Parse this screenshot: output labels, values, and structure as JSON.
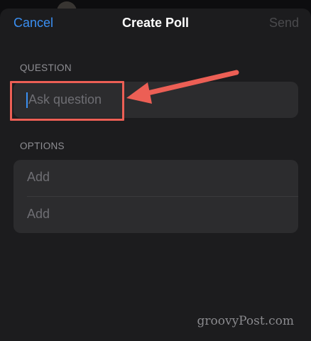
{
  "navbar": {
    "cancel_label": "Cancel",
    "title": "Create Poll",
    "send_label": "Send"
  },
  "question": {
    "section_label": "QUESTION",
    "placeholder": "Ask question"
  },
  "options": {
    "section_label": "OPTIONS",
    "items": [
      {
        "placeholder": "Add"
      },
      {
        "placeholder": "Add"
      }
    ]
  },
  "annotation": {
    "highlight_color": "#ec5f55",
    "arrow_color": "#ec5f55"
  },
  "watermark": "groovyPost.com",
  "colors": {
    "accent": "#3a8ff2",
    "background": "#1c1c1e",
    "field": "#2c2c2e",
    "secondary_text": "#8e8e93",
    "disabled_text": "#4a4a4d"
  }
}
